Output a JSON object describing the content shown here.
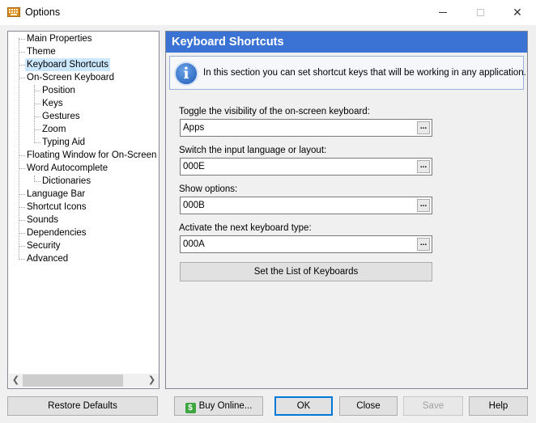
{
  "window": {
    "title": "Options",
    "icon": "keyboard-icon"
  },
  "tree": {
    "items": [
      {
        "label": "Main Properties"
      },
      {
        "label": "Theme"
      },
      {
        "label": "Keyboard Shortcuts"
      },
      {
        "label": "On-Screen Keyboard"
      },
      {
        "label": "Position"
      },
      {
        "label": "Keys"
      },
      {
        "label": "Gestures"
      },
      {
        "label": "Zoom"
      },
      {
        "label": "Typing Aid"
      },
      {
        "label": "Floating Window for On-Screen Ke"
      },
      {
        "label": "Word Autocomplete"
      },
      {
        "label": "Dictionaries"
      },
      {
        "label": "Language Bar"
      },
      {
        "label": "Shortcut Icons"
      },
      {
        "label": "Sounds"
      },
      {
        "label": "Dependencies"
      },
      {
        "label": "Security"
      },
      {
        "label": "Advanced"
      }
    ],
    "selected": "Keyboard Shortcuts"
  },
  "panel": {
    "title": "Keyboard Shortcuts",
    "info": "In this section you can set shortcut keys that will be working in any application.",
    "fields": [
      {
        "label": "Toggle the visibility of the on-screen keyboard:",
        "value": "Apps"
      },
      {
        "label": "Switch the input language or layout:",
        "value": "000E"
      },
      {
        "label": "Show options:",
        "value": "000B"
      },
      {
        "label": "Activate the next keyboard type:",
        "value": "000A"
      }
    ],
    "dots_label": "...",
    "set_list_button": "Set the List of Keyboards"
  },
  "buttons": {
    "restore": "Restore Defaults",
    "buy": "Buy Online...",
    "ok": "OK",
    "close": "Close",
    "save": "Save",
    "help": "Help"
  },
  "colors": {
    "header_bg": "#3a73d4",
    "selected_bg": "#cce8ff",
    "default_border": "#0078d7"
  }
}
